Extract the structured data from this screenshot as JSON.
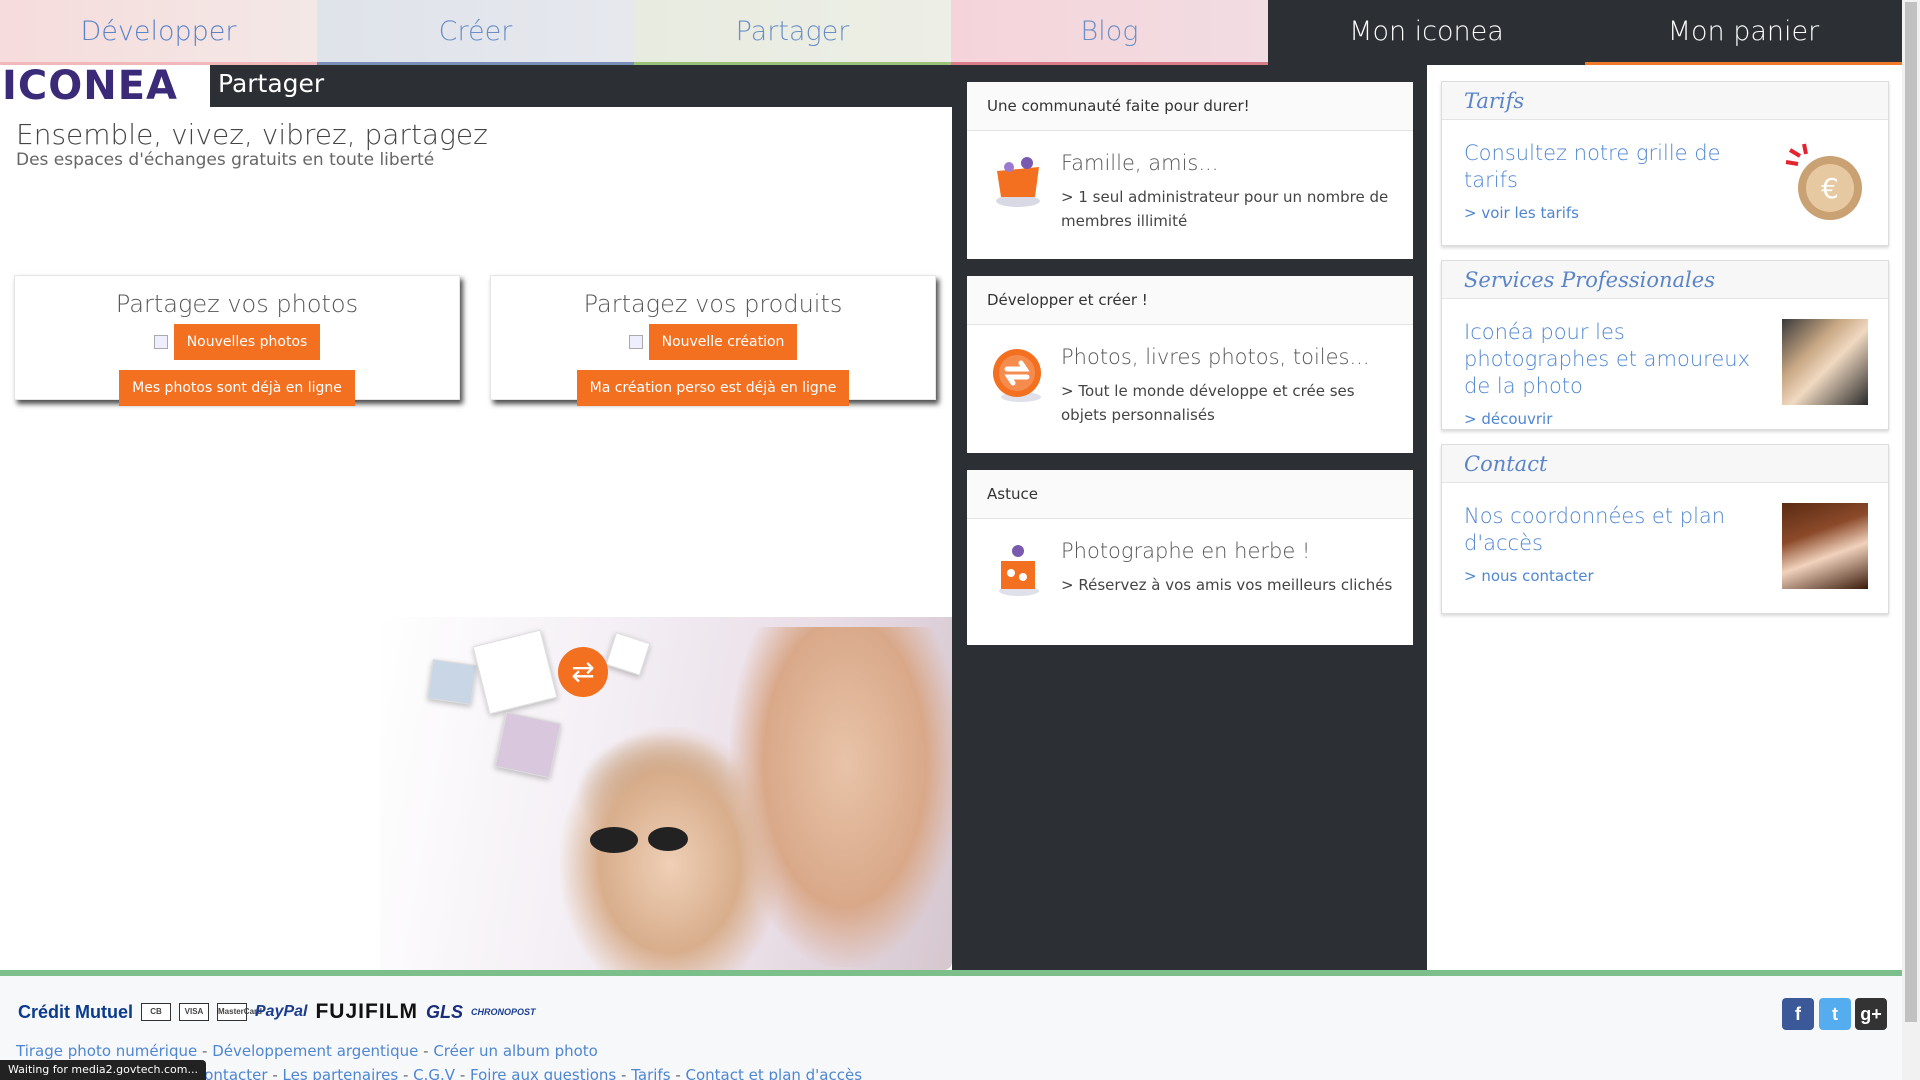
{
  "nav": {
    "items": [
      {
        "label": "Développer"
      },
      {
        "label": "Créer"
      },
      {
        "label": "Partager"
      },
      {
        "label": "Blog"
      },
      {
        "label": "Mon iconea"
      },
      {
        "label": "Mon panier"
      }
    ],
    "colors": {
      "dark": "#2c2f33",
      "accent": "#f07a2a"
    }
  },
  "brand": {
    "logo_text": "ICONEA",
    "section": "Partager"
  },
  "hero": {
    "title": "Ensemble, vivez, vibrez, partagez",
    "subtitle": "Des espaces d'échanges gratuits en toute liberté"
  },
  "share": {
    "photos": {
      "title": "Partagez vos photos",
      "new_button": "Nouvelles photos",
      "online_button": "Mes photos sont déjà en ligne"
    },
    "products": {
      "title": "Partagez vos produits",
      "new_button": "Nouvelle création",
      "online_button": "Ma création perso est déjà en ligne"
    }
  },
  "middle": {
    "cards": [
      {
        "header": "Une communauté faite pour durer!",
        "title": "Famille, amis...",
        "desc": "> 1 seul administrateur pour un nombre de membres illimité",
        "icon": "community-icon"
      },
      {
        "header": "Développer et créer !",
        "title": "Photos, livres photos, toiles...",
        "desc": "> Tout le monde développe et crée ses objets personnalisés",
        "icon": "exchange-icon"
      },
      {
        "header": "Astuce",
        "title": "Photographe en herbe !",
        "desc": "> Réservez à vos amis vos meilleurs clichés",
        "icon": "gift-icon"
      }
    ]
  },
  "right": {
    "cards": [
      {
        "header": "Tarifs",
        "title": "Consultez notre grille de tarifs",
        "link": "> voir les tarifs",
        "image": "euro-coin-icon"
      },
      {
        "header": "Services Professionales",
        "title": "Iconéa pour les photographes et amoureux de la photo",
        "link": "> découvrir",
        "image": "photographer-photo"
      },
      {
        "header": "Contact",
        "title": "Nos coordonnées et plan d'accès",
        "link": "> nous contacter",
        "image": "operator-photo"
      }
    ]
  },
  "footer": {
    "payments": [
      "Crédit Mutuel",
      "PayPal",
      "FUJIFILM",
      "GLS",
      "CHRONOPOST"
    ],
    "cards": [
      "CB",
      "VISA",
      "MasterCard"
    ],
    "links_row1": [
      "Tirage photo numérique",
      "Développement argentique",
      "Créer un album photo"
    ],
    "links_row2": [
      "contacter",
      "Les partenaires",
      "C.G.V",
      "Foire aux questions",
      "Tarifs",
      "Contact et plan d'accès"
    ],
    "social": [
      "facebook-icon",
      "twitter-icon",
      "google-plus-icon"
    ]
  },
  "status_bar": "Waiting for media2.govtech.com..."
}
